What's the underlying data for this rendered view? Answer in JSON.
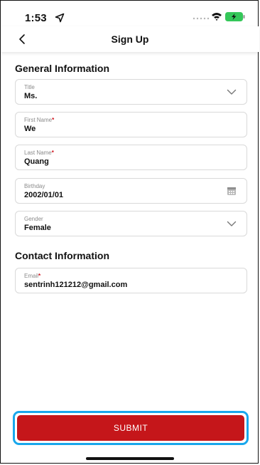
{
  "status_bar": {
    "time": "1:53",
    "icons": [
      "location-arrow-icon",
      "signal-icon",
      "wifi-icon",
      "battery-charging-icon"
    ],
    "battery_color": "#34c759"
  },
  "header": {
    "title": "Sign Up",
    "back_icon": "chevron-left-icon"
  },
  "general_section": {
    "heading": "General Information",
    "fields": {
      "title": {
        "label": "Title",
        "value": "Ms.",
        "icon": "chevron-down-icon"
      },
      "first_name": {
        "label": "First Name",
        "required_mark": "*",
        "value": "We"
      },
      "last_name": {
        "label": "Last Name",
        "required_mark": "*",
        "value": "Quang"
      },
      "birthday": {
        "label": "Birthday",
        "value": "2002/01/01",
        "icon": "calendar-icon"
      },
      "gender": {
        "label": "Gender",
        "value": "Female",
        "icon": "chevron-down-icon"
      }
    }
  },
  "contact_section": {
    "heading": "Contact Information",
    "fields": {
      "email": {
        "label": "Email",
        "required_mark": "*",
        "value": "sentrinh121212@gmail.com"
      }
    }
  },
  "submit": {
    "label": "SUBMIT"
  },
  "colors": {
    "accent_red": "#c5161a",
    "focus_ring": "#19a7ec",
    "required": "#d0101a",
    "border": "#d9d9d9"
  }
}
